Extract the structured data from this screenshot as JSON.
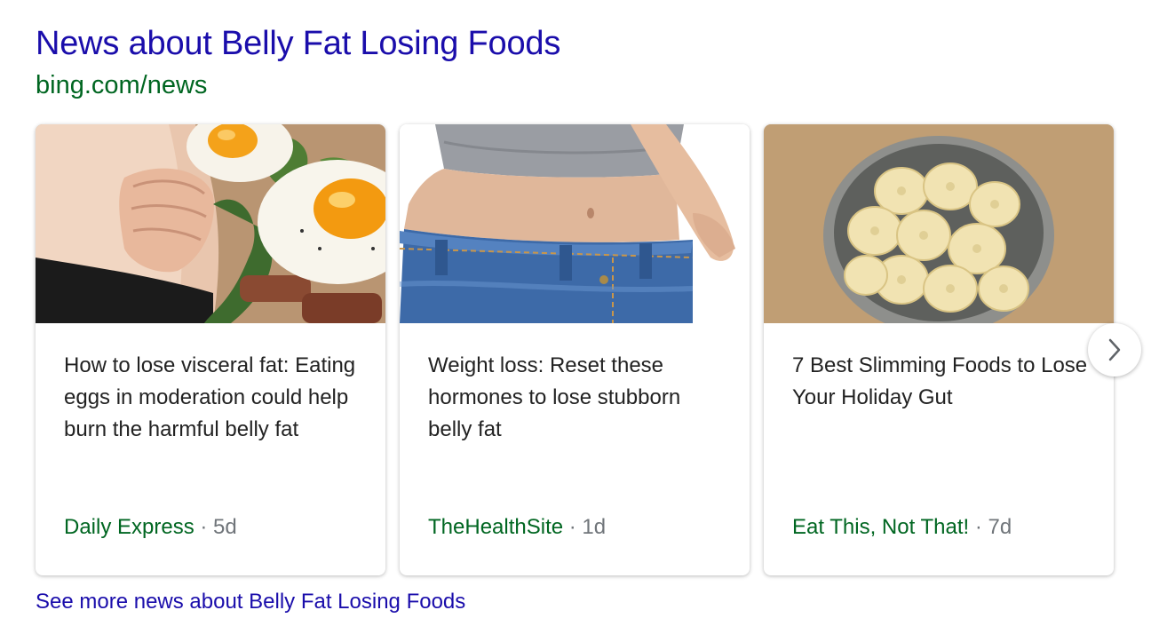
{
  "header": {
    "title": "News about Belly Fat Losing Foods",
    "url": "bing.com/news"
  },
  "cards": [
    {
      "headline": "How to lose visceral fat: Eating eggs in moderation could help burn the harmful belly fat",
      "source": "Daily Express",
      "separator": " · ",
      "age": "5d",
      "image": "fried-eggs-belly-photo"
    },
    {
      "headline": "Weight loss: Reset these hormones to lose stubborn belly fat",
      "source": "TheHealthSite",
      "separator": " · ",
      "age": "1d",
      "image": "loose-jeans-waist-photo"
    },
    {
      "headline": "7 Best Slimming Foods to Lose Your Holiday Gut",
      "source": "Eat This, Not That!",
      "separator": " · ",
      "age": "7d",
      "image": "banana-slices-bowl-photo"
    }
  ],
  "carousel": {
    "next_icon": "chevron-right-icon"
  },
  "footer": {
    "see_more": "See more news about Belly Fat Losing Foods"
  },
  "colors": {
    "title": "#1a0dab",
    "url": "#006621",
    "source": "#006621",
    "age": "#70757a",
    "headline": "#222222"
  }
}
